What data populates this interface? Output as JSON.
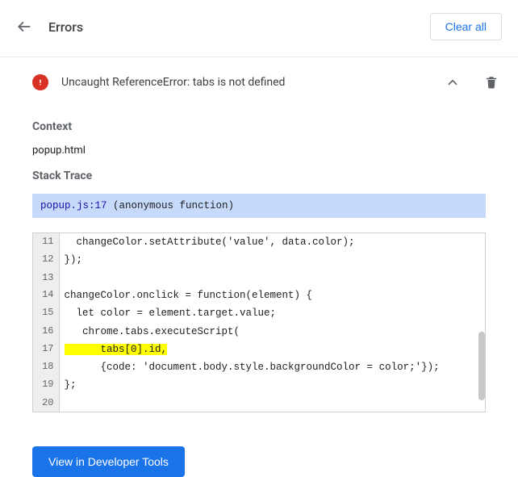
{
  "header": {
    "title": "Errors",
    "clear_all": "Clear all"
  },
  "error": {
    "message": "Uncaught ReferenceError: tabs is not defined",
    "context_label": "Context",
    "context_value": "popup.html",
    "stack_label": "Stack Trace",
    "stack_file": "popup.js:17",
    "stack_fn": "(anonymous function)",
    "highlight_line": 17,
    "lines": [
      {
        "n": 11,
        "code": "  changeColor.setAttribute('value', data.color);"
      },
      {
        "n": 12,
        "code": "});"
      },
      {
        "n": 13,
        "code": ""
      },
      {
        "n": 14,
        "code": "changeColor.onclick = function(element) {"
      },
      {
        "n": 15,
        "code": "  let color = element.target.value;"
      },
      {
        "n": 16,
        "code": "   chrome.tabs.executeScript("
      },
      {
        "n": 17,
        "code": "      tabs[0].id,"
      },
      {
        "n": 18,
        "code": "      {code: 'document.body.style.backgroundColor = color;'});"
      },
      {
        "n": 19,
        "code": "};"
      },
      {
        "n": 20,
        "code": ""
      }
    ]
  },
  "footer": {
    "dev_tools": "View in Developer Tools"
  }
}
